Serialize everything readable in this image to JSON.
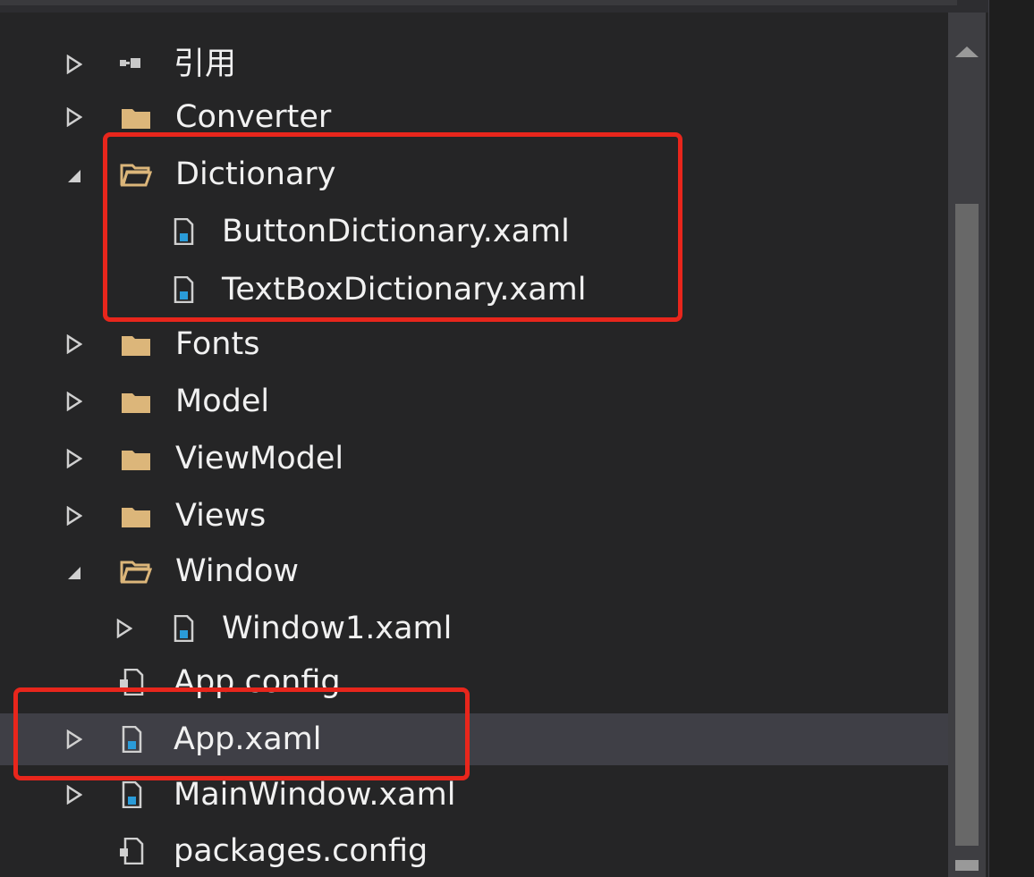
{
  "tree": {
    "references": "引用",
    "converter": "Converter",
    "dictionary": "Dictionary",
    "button_dictionary": "ButtonDictionary.xaml",
    "textbox_dictionary": "TextBoxDictionary.xaml",
    "fonts": "Fonts",
    "model": "Model",
    "viewmodel": "ViewModel",
    "views": "Views",
    "window": "Window",
    "window1": "Window1.xaml",
    "app_config": "App.config",
    "app_xaml": "App.xaml",
    "mainwindow": "MainWindow.xaml",
    "packages_config": "packages.config"
  },
  "colors": {
    "background": "#252526",
    "selected_row": "#3f3f46",
    "highlight_box": "#e8261c",
    "folder": "#dcb67a",
    "xaml_icon_accent": "#2a9bd8"
  },
  "icons": {
    "references": "references-icon",
    "folder": "folder-icon",
    "folder_open": "folder-open-icon",
    "xaml_file": "xaml-file-icon",
    "config_file": "config-file-icon"
  }
}
